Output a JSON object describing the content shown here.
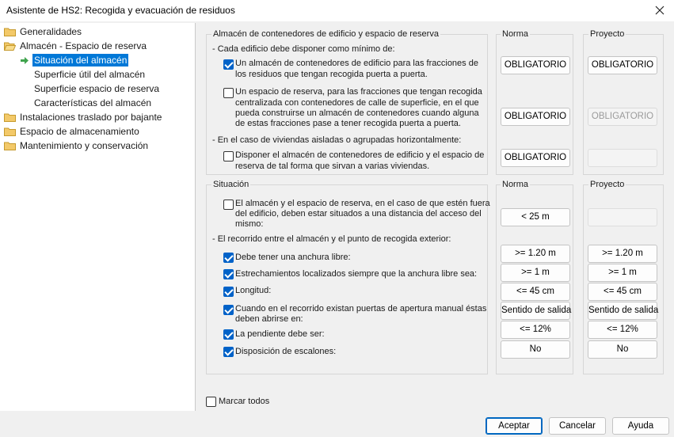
{
  "window": {
    "title": "Asistente de HS2: Recogida y evacuación de residuos"
  },
  "tree": {
    "items": [
      {
        "label": "Generalidades"
      },
      {
        "label": "Almacén - Espacio de reserva"
      },
      {
        "label": "Situación del almacén"
      },
      {
        "label": "Superficie útil del almacén"
      },
      {
        "label": "Superficie espacio de reserva"
      },
      {
        "label": "Características del almacén"
      },
      {
        "label": "Instalaciones traslado por bajante"
      },
      {
        "label": "Espacio de almacenamiento"
      },
      {
        "label": "Mantenimiento y conservación"
      }
    ]
  },
  "section1": {
    "title": "Almacén de contenedores de edificio y espacio de reserva",
    "norma_title": "Norma",
    "proyecto_title": "Proyecto",
    "intro": "- Cada edificio debe disponer como mínimo de:",
    "option1": {
      "line1": "Un almacén de contenedores de edificio para las fracciones de",
      "line2": "los residuos que tengan recogida puerta a puerta.",
      "checked": true,
      "norma": "OBLIGATORIO",
      "proyecto": "OBLIGATORIO"
    },
    "option2": {
      "line1": "Un espacio de reserva, para las fracciones que tengan recogida",
      "line2": "centralizada con contenedores de calle de superficie, en el que",
      "line3": "pueda construirse un almacén de contenedores cuando alguna",
      "line4": "de estas fracciones pase a tener recogida puerta a puerta.",
      "checked": false,
      "norma": "OBLIGATORIO",
      "proyecto": "OBLIGATORIO"
    },
    "intro2": "- En el caso de viviendas aisladas o agrupadas horizontalmente:",
    "option3": {
      "line1": "Disponer el almacén de contenedores de edificio y el espacio de",
      "line2": "reserva de tal forma que sirvan a varias viviendas.",
      "checked": false,
      "norma": "OBLIGATORIO",
      "proyecto": ""
    }
  },
  "section2": {
    "title": "Situación",
    "norma_title": "Norma",
    "proyecto_title": "Proyecto",
    "option1": {
      "line1": "El almacén y el espacio de reserva, en el caso de que estén fuera",
      "line2": "del edificio, deben estar situados a una distancia del acceso del",
      "line3": "mismo:",
      "checked": false,
      "norma": "< 25 m",
      "proyecto": ""
    },
    "intro": "- El recorrido entre el almacén y el punto de recogida exterior:",
    "rows": [
      {
        "label": "Debe tener una anchura libre:",
        "checked": true,
        "norma": ">= 1.20 m",
        "proyecto": ">= 1.20 m"
      },
      {
        "label": "Estrechamientos localizados siempre que la anchura libre sea:",
        "checked": true,
        "norma": ">= 1 m",
        "proyecto": ">= 1 m"
      },
      {
        "label": "Longitud:",
        "checked": true,
        "norma": "<= 45 cm",
        "proyecto": "<= 45 cm"
      },
      {
        "label": "Cuando en el recorrido existan puertas de apertura manual éstas",
        "label2": "deben abrirse en:",
        "checked": true,
        "norma": "Sentido de salida",
        "proyecto": "Sentido de salida"
      },
      {
        "label": "La pendiente debe ser:",
        "checked": true,
        "norma": "<= 12%",
        "proyecto": "<= 12%"
      },
      {
        "label": "Disposición de escalones:",
        "checked": true,
        "norma": "No",
        "proyecto": "No"
      }
    ]
  },
  "footer": {
    "mark_all": "Marcar todos",
    "mark_all_checked": false,
    "accept": "Aceptar",
    "cancel": "Cancelar",
    "help": "Ayuda"
  },
  "colors": {
    "accent": "#0078d7",
    "folder": "#e8b84a",
    "arrow": "#4caf50"
  }
}
